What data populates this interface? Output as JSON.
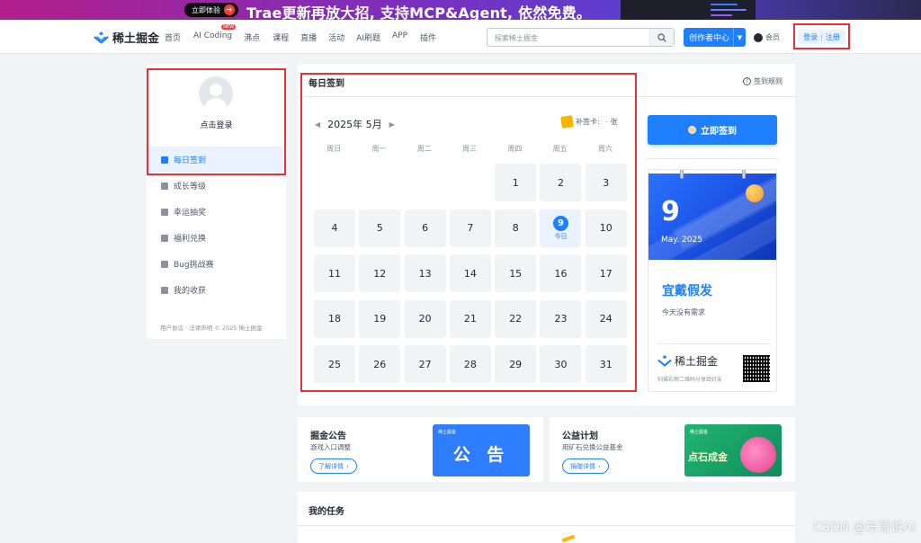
{
  "banner": {
    "cta_label": "立即体验",
    "headline": "Trae更新再放大招, 支持MCP&Agent, 依然免费。"
  },
  "nav": {
    "logo_text": "稀土掘金",
    "items": [
      "首页",
      "AI Coding",
      "沸点",
      "课程",
      "直播",
      "活动",
      "AI刷题",
      "APP",
      "插件"
    ],
    "new_badge": "NEW",
    "search_placeholder": "探索稀土掘金",
    "creator_label": "创作者中心",
    "vip_label": "会员",
    "login_label": "登录",
    "register_label": "注册",
    "login_sep": "|"
  },
  "sidebar": {
    "click_login": "点击登录",
    "items": [
      {
        "label": "每日签到",
        "active": true
      },
      {
        "label": "成长等级"
      },
      {
        "label": "幸运抽奖"
      },
      {
        "label": "福利兑换"
      },
      {
        "label": "Bug挑战赛"
      },
      {
        "label": "我的收获"
      }
    ],
    "footer": "用户协议 · 法律声明 © 2025 稀土掘金"
  },
  "checkin": {
    "title": "每日签到",
    "rules_label": "签到规则",
    "month_label": "2025年 5月",
    "makeup_label": "补签卡:",
    "makeup_count": "-",
    "makeup_unit": "张",
    "weekdays": [
      "周日",
      "周一",
      "周二",
      "周三",
      "周四",
      "周五",
      "周六"
    ],
    "leading_blanks": 4,
    "days": [
      "1",
      "2",
      "3",
      "4",
      "5",
      "6",
      "7",
      "8",
      "9",
      "10",
      "11",
      "12",
      "13",
      "14",
      "15",
      "16",
      "17",
      "18",
      "19",
      "20",
      "21",
      "22",
      "23",
      "24",
      "25",
      "26",
      "27",
      "28",
      "29",
      "30",
      "31"
    ],
    "today": "9",
    "today_label": "今日",
    "signin_button": "立即签到"
  },
  "daycard": {
    "day": "9",
    "month": "May. 2025",
    "yi": "宜戴假发",
    "note": "今天没有需求",
    "brand": "稀土掘金",
    "scan_hint": "扫描右侧二维码分享给好友"
  },
  "cards": [
    {
      "title": "掘金公告",
      "desc": "游戏入口调整",
      "button": "了解详情",
      "promo_text": "公 告",
      "promo_mini": "稀土掘金"
    },
    {
      "title": "公益计划",
      "desc": "用矿石兑换公益基金",
      "button": "捐赠详情",
      "promo_text": "点石成金",
      "promo_mini": "稀土掘金"
    }
  ],
  "tasks": {
    "title": "我的任务"
  },
  "watermark": "CSDN @东哥说AI",
  "colors": {
    "accent": "#1e80ff",
    "highlight_border": "#e6313a",
    "page_bg": "#f2f3f5"
  }
}
